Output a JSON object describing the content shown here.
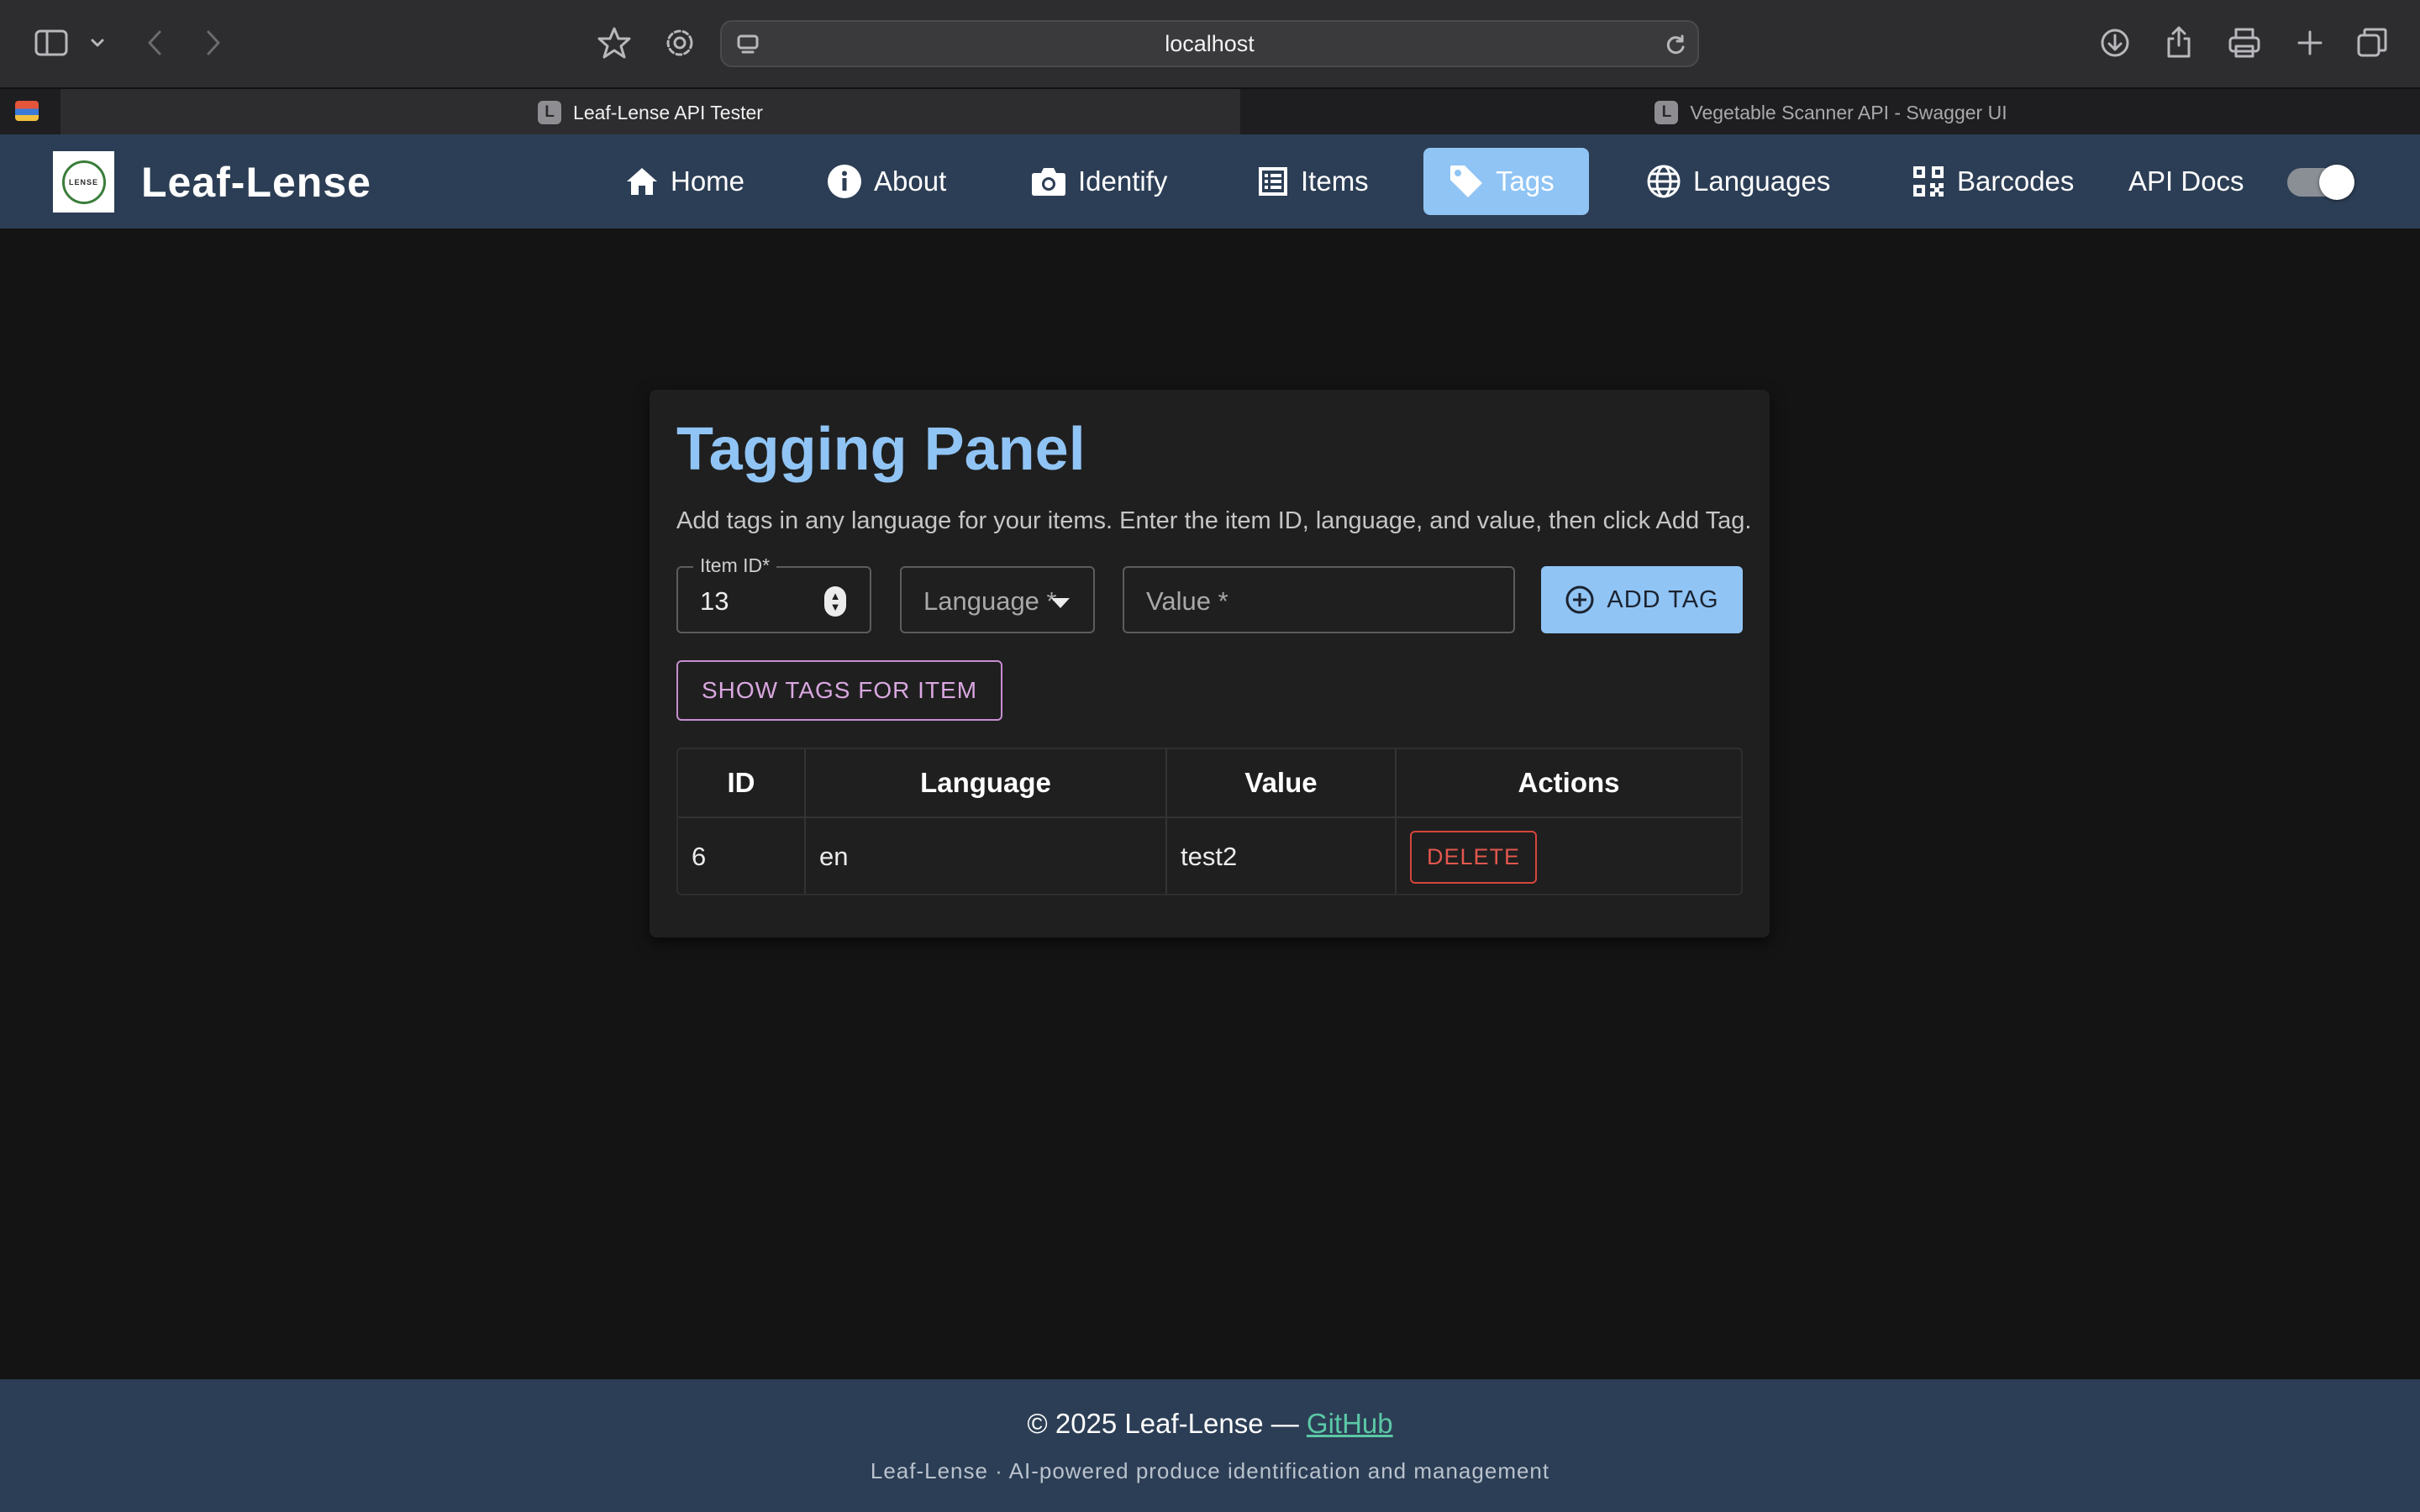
{
  "browser": {
    "url": "localhost",
    "tabs": [
      {
        "favicon": "L",
        "title": "Leaf-Lense API Tester",
        "active": true
      },
      {
        "favicon": "L",
        "title": "Vegetable Scanner API - Swagger UI",
        "active": false
      }
    ]
  },
  "app": {
    "brand": "Leaf-Lense",
    "logo_text": "LENSE",
    "nav": [
      {
        "label": "Home",
        "icon": "home-icon"
      },
      {
        "label": "About",
        "icon": "info-icon"
      },
      {
        "label": "Identify",
        "icon": "camera-icon"
      },
      {
        "label": "Items",
        "icon": "list-icon"
      },
      {
        "label": "Tags",
        "icon": "tag-icon",
        "active": true
      },
      {
        "label": "Languages",
        "icon": "globe-icon"
      },
      {
        "label": "Barcodes",
        "icon": "qr-code-icon"
      },
      {
        "label": "API Docs"
      }
    ],
    "theme_toggle_on": true
  },
  "panel": {
    "title": "Tagging Panel",
    "description": "Add tags in any language for your items. Enter the item ID, language, and value, then click Add Tag.",
    "item_id": {
      "label": "Item ID",
      "required_mark": "*",
      "value": "13"
    },
    "language": {
      "placeholder": "Language *",
      "value": ""
    },
    "value_field": {
      "placeholder": "Value *",
      "value": ""
    },
    "add_button": "ADD TAG",
    "show_button": "SHOW TAGS FOR ITEM",
    "table": {
      "headers": [
        "ID",
        "Language",
        "Value",
        "Actions"
      ],
      "rows": [
        {
          "id": "6",
          "language": "en",
          "value": "test2",
          "action": "DELETE"
        }
      ]
    }
  },
  "footer": {
    "copyright": "© 2025 Leaf-Lense —",
    "link": "GitHub",
    "tagline": "Leaf-Lense · AI-powered produce identification and management"
  },
  "colors": {
    "accent": "#90c4f5",
    "header_bg": "#2c3e55",
    "page_bg": "#141414",
    "danger": "#e2574d",
    "secondary": "#d9a7e0",
    "link": "#5bc8a6"
  }
}
